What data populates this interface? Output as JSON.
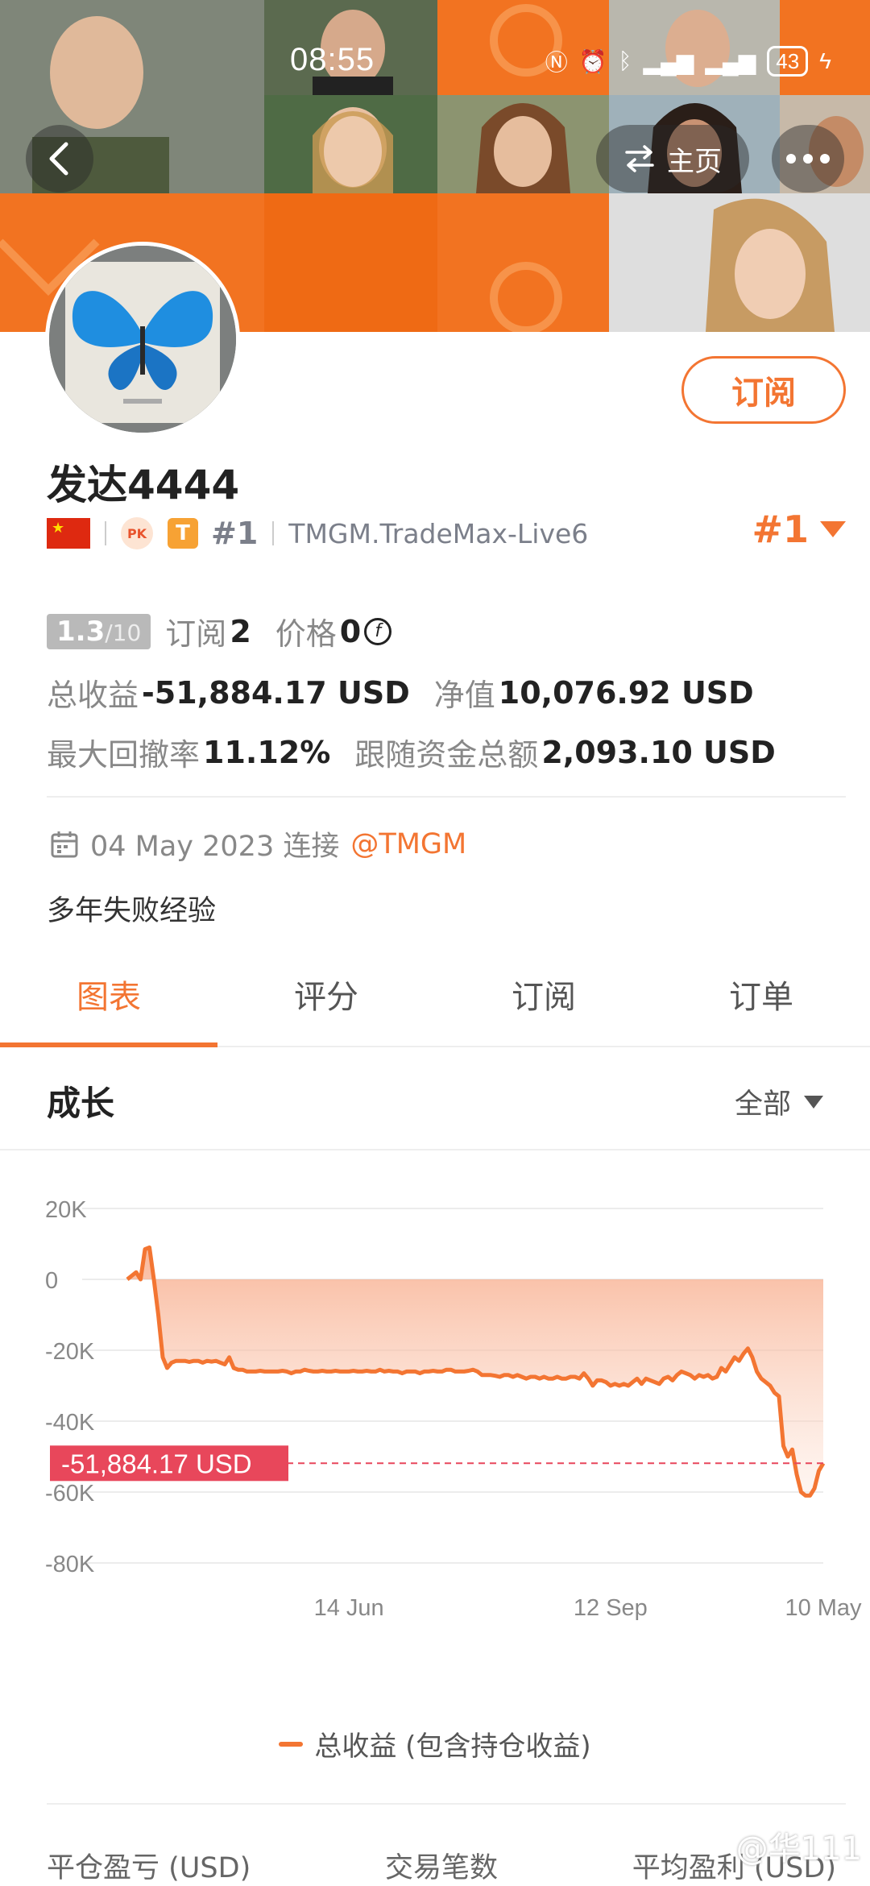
{
  "status_bar": {
    "time": "08:55",
    "icons": [
      "nfc-icon",
      "alarm-icon",
      "bluetooth-icon",
      "signal-4g-icon",
      "signal-4g-icon",
      "battery-icon"
    ],
    "battery": "43"
  },
  "header": {
    "home_label": "主页"
  },
  "profile": {
    "name": "发达4444",
    "subscribe_label": "订阅",
    "pk_badge": "PK",
    "t_badge": "T",
    "rank": "#1",
    "server": "TMGM.TradeMax-Live6",
    "rank_right": "#1",
    "score": "1.3",
    "score_max": "/10",
    "subscribe_count_label": "订阅",
    "subscribe_count": "2",
    "price_label": "价格",
    "price_value": "0",
    "total_profit_label": "总收益",
    "total_profit_value": "-51,884.17 USD",
    "net_value_label": "净值",
    "net_value_value": "10,076.92 USD",
    "max_drawdown_label": "最大回撤率",
    "max_drawdown_value": "11.12%",
    "follow_funds_label": "跟随资金总额",
    "follow_funds_value": "2,093.10 USD",
    "connect_date": "04 May 2023 连接",
    "connect_broker": "@TMGM",
    "bio": "多年失败经验"
  },
  "tabs": [
    "图表",
    "评分",
    "订阅",
    "订单"
  ],
  "active_tab": 0,
  "section": {
    "title": "成长",
    "filter": "全部"
  },
  "colors": {
    "accent": "#f37532",
    "label_red": "#e8475b"
  },
  "chart_data": {
    "type": "area",
    "title": "",
    "xlabel": "",
    "ylabel": "",
    "ylim": [
      -80000,
      20000
    ],
    "yticks": [
      20000,
      0,
      -20000,
      -40000,
      -60000,
      -80000
    ],
    "ytick_labels": [
      "20K",
      "0",
      "-20K",
      "-40K",
      "-60K",
      "-80K"
    ],
    "xtick_labels": [
      "14 Jun",
      "12 Sep",
      "10 May"
    ],
    "xtick_index": [
      50,
      109,
      157
    ],
    "current_value_label": "-51,884.17 USD",
    "current_value": -51884.17,
    "series": [
      {
        "name": "总收益 (包含持仓收益)",
        "values": [
          0,
          1000,
          2000,
          0,
          8500,
          9000,
          0,
          -10000,
          -22000,
          -25000,
          -23500,
          -23000,
          -23000,
          -23000,
          -23300,
          -23000,
          -23000,
          -23500,
          -23000,
          -23200,
          -23000,
          -23500,
          -24000,
          -22000,
          -25000,
          -25500,
          -25500,
          -26000,
          -26000,
          -26000,
          -25800,
          -26000,
          -26000,
          -26000,
          -26000,
          -25800,
          -26000,
          -26500,
          -26000,
          -26000,
          -25500,
          -25800,
          -26000,
          -26000,
          -25800,
          -26000,
          -26000,
          -25800,
          -26000,
          -26000,
          -26000,
          -25800,
          -26000,
          -26000,
          -25800,
          -26000,
          -26000,
          -25500,
          -26000,
          -25800,
          -26000,
          -26000,
          -26500,
          -26000,
          -26000,
          -26000,
          -26500,
          -26000,
          -26000,
          -25800,
          -26000,
          -26000,
          -25500,
          -25500,
          -26000,
          -26000,
          -26000,
          -25800,
          -25500,
          -26000,
          -27000,
          -27000,
          -27000,
          -27200,
          -27500,
          -27000,
          -27000,
          -27500,
          -27000,
          -27500,
          -28000,
          -27500,
          -27500,
          -28000,
          -27500,
          -28000,
          -28000,
          -27500,
          -28000,
          -28000,
          -27500,
          -27500,
          -28000,
          -26500,
          -28000,
          -30000,
          -28500,
          -28500,
          -29000,
          -30000,
          -29500,
          -30000,
          -29500,
          -30000,
          -29000,
          -28000,
          -29500,
          -28000,
          -28500,
          -29000,
          -29500,
          -28000,
          -27500,
          -28500,
          -27000,
          -26000,
          -26500,
          -27000,
          -28000,
          -27000,
          -27500,
          -27000,
          -28000,
          -27500,
          -25000,
          -26000,
          -24000,
          -22000,
          -23000,
          -21000,
          -19500,
          -22000,
          -26000,
          -28000,
          -29000,
          -30000,
          -32000,
          -33000,
          -47000,
          -50000,
          -48000,
          -55000,
          -60000,
          -61000,
          -61000,
          -59000,
          -54000,
          -51884
        ]
      }
    ],
    "legend": "总收益 (包含持仓收益)",
    "grid": true
  },
  "bottom_labels": [
    "平仓盈亏 (USD)",
    "交易笔数",
    "平均盈利 (USD)"
  ],
  "watermark": "@华111"
}
